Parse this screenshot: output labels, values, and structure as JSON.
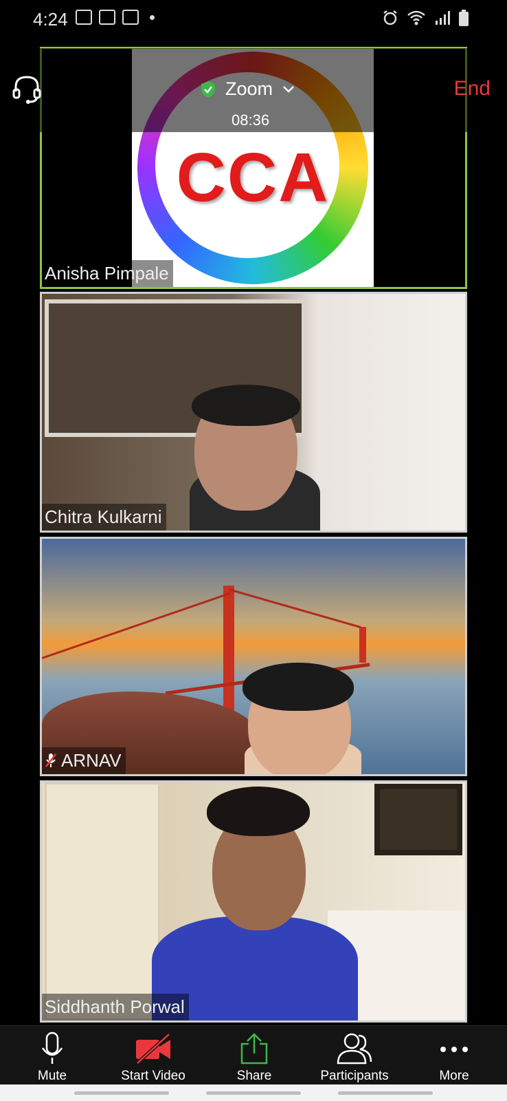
{
  "status_bar": {
    "time": "4:24"
  },
  "meeting": {
    "title": "Zoom",
    "timer": "08:36",
    "end_label": "End",
    "accent_end": "#e8383d",
    "active_speaker_border": "#8dc63f"
  },
  "tiles": [
    {
      "name": "Anisha Pimpale",
      "content_text": "CCA",
      "active": true,
      "muted": false
    },
    {
      "name": "Chitra Kulkarni",
      "active": false,
      "muted": false
    },
    {
      "name": "ARNAV",
      "active": false,
      "muted": true
    },
    {
      "name": "Siddhanth Porwal",
      "active": false,
      "muted": false
    }
  ],
  "toolbar": {
    "mute_label": "Mute",
    "start_video_label": "Start Video",
    "share_label": "Share",
    "participants_label": "Participants",
    "more_label": "More"
  },
  "icons": {
    "audio": "headphones-icon",
    "secure": "shield-check-icon",
    "mic": "microphone-icon",
    "video_off": "video-off-icon",
    "share": "share-arrow-icon",
    "participants": "participants-icon",
    "more": "more-dots-icon"
  },
  "colors": {
    "video_off_red": "#e8383d",
    "share_green": "#3db84b"
  }
}
